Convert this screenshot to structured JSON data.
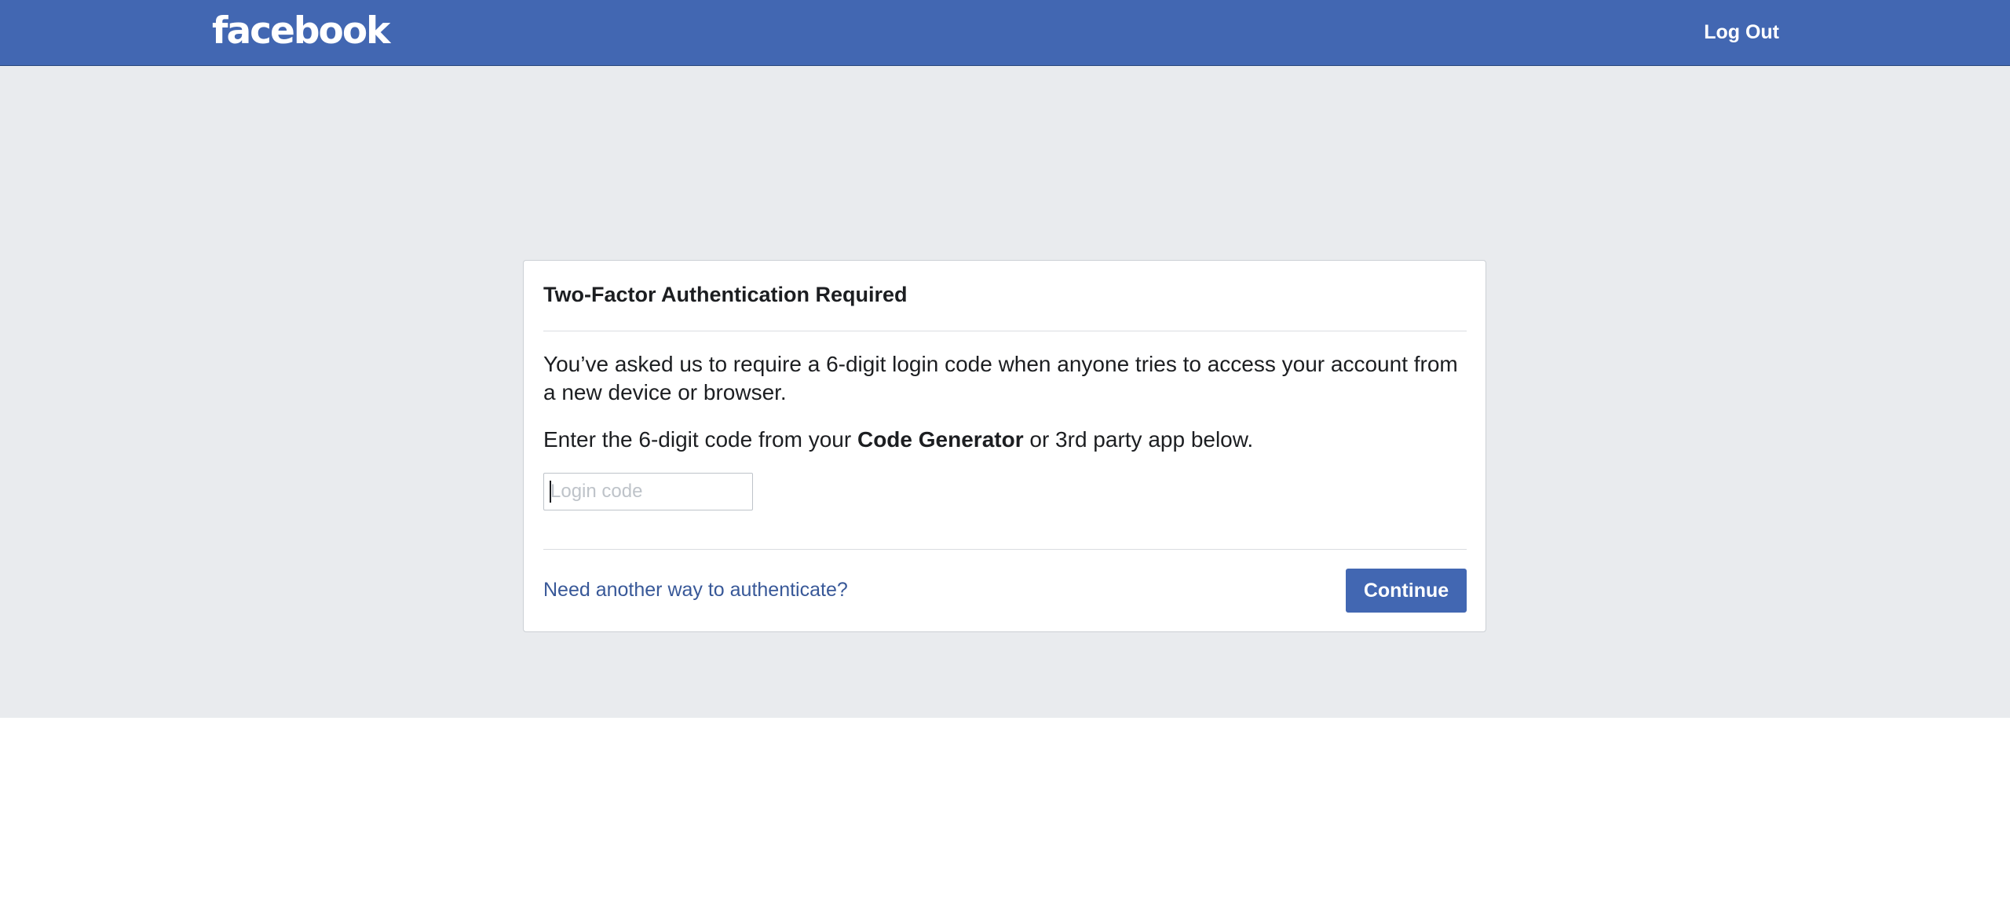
{
  "header": {
    "logo_text": "facebook",
    "logout_label": "Log Out",
    "bar_color": "#4267b2"
  },
  "card": {
    "title": "Two-Factor Authentication Required",
    "paragraph1": "You’ve asked us to require a 6-digit login code when anyone tries to access your account from a new device or browser.",
    "paragraph2_before": "Enter the 6-digit code from your ",
    "paragraph2_bold": "Code Generator",
    "paragraph2_after": " or 3rd party app below.",
    "code_input": {
      "value": "",
      "placeholder": "Login code"
    },
    "alt_link_label": "Need another way to authenticate?",
    "continue_label": "Continue"
  },
  "colors": {
    "page_background": "#e9ebee",
    "link": "#385898",
    "button": "#4267b2"
  }
}
